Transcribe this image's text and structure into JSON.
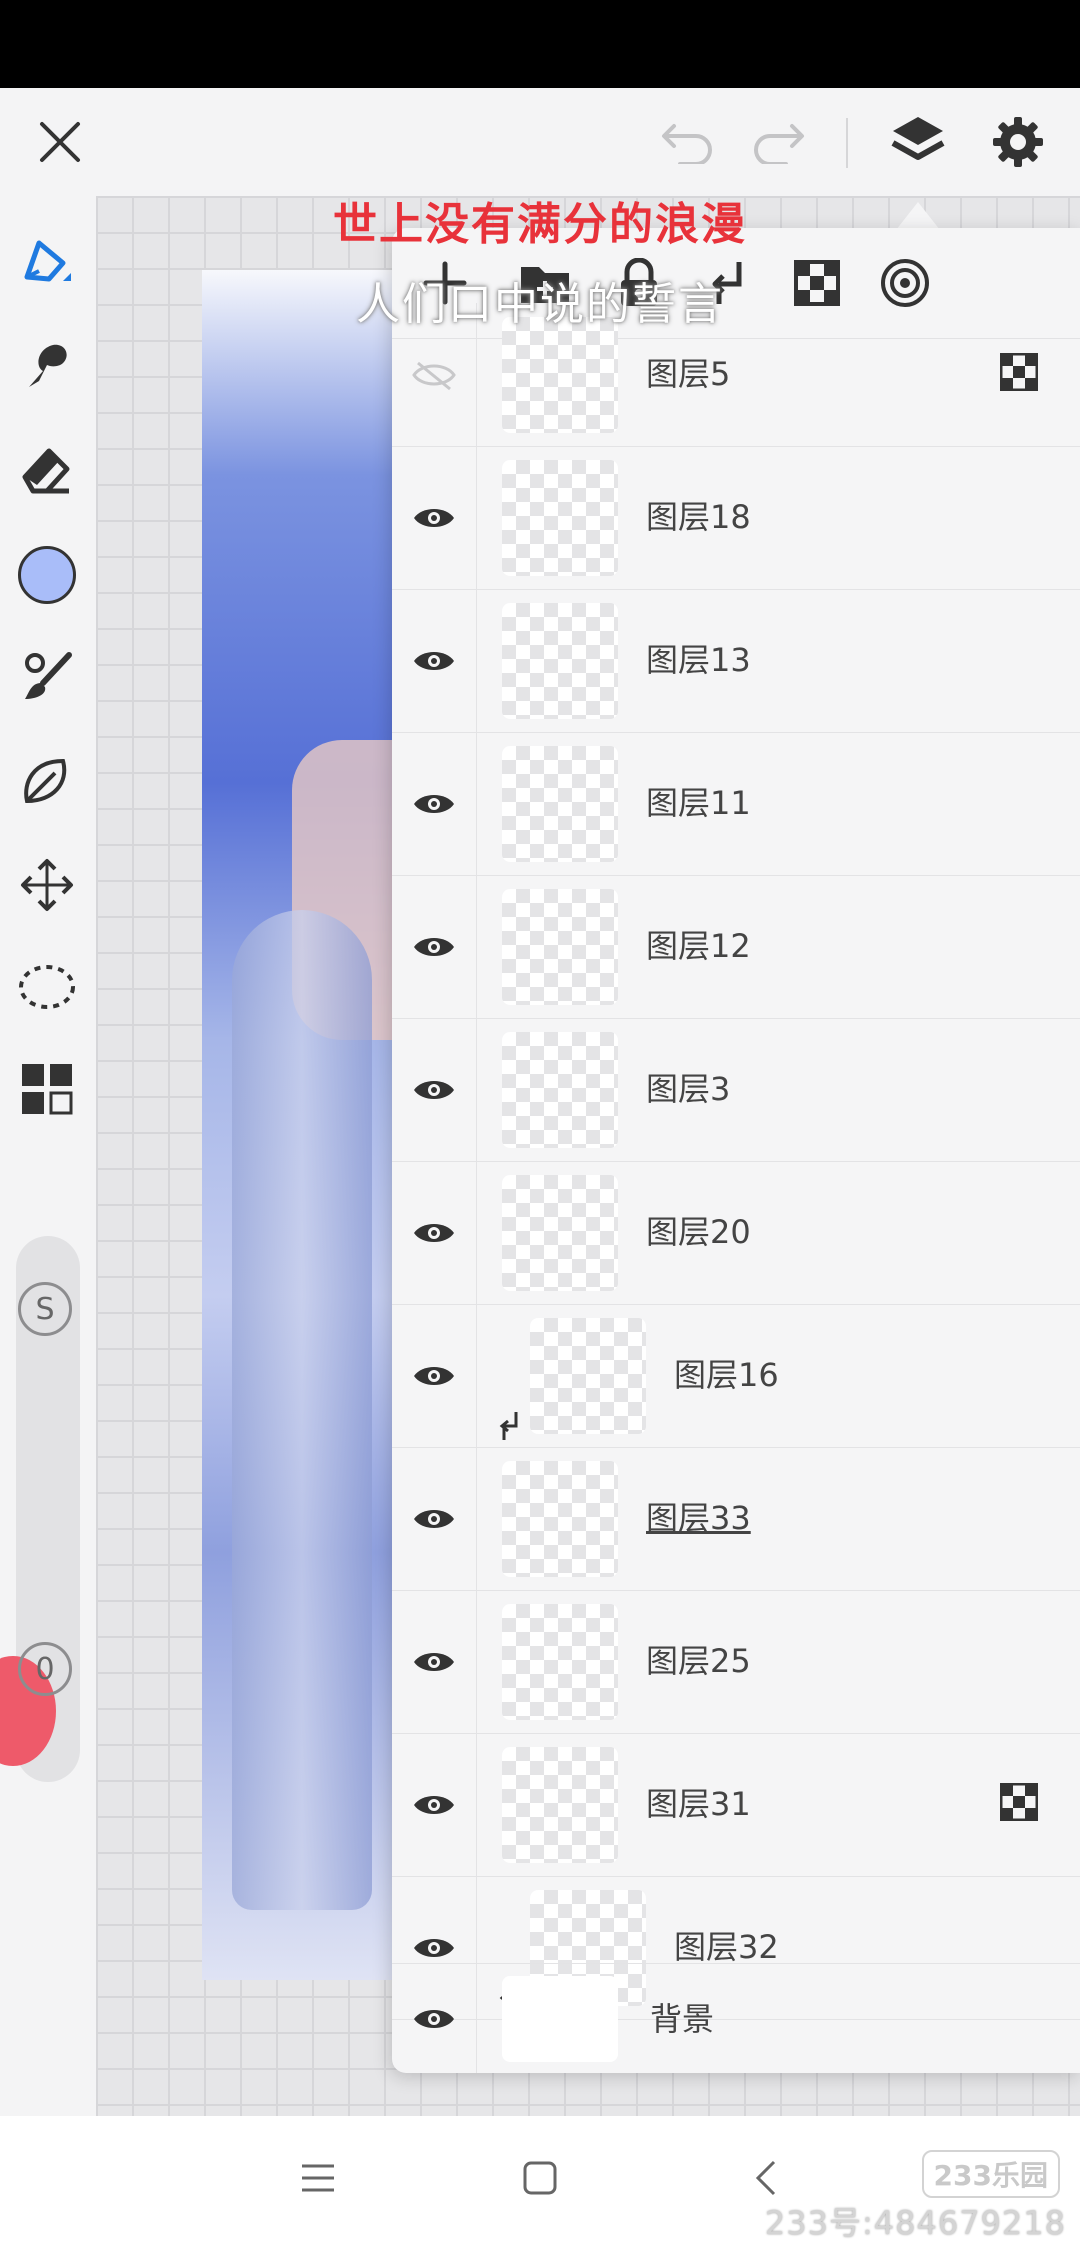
{
  "overlay": {
    "title": "世上没有满分的浪漫",
    "subtitle": "人们口中说的誓言"
  },
  "toolbar": {
    "icons": [
      "close-icon",
      "undo-icon",
      "redo-icon",
      "layers-icon",
      "settings-icon"
    ]
  },
  "tools": [
    "pen-icon",
    "smudge-icon",
    "eraser-icon",
    "color-swatch",
    "brush-icon",
    "lasso-fill-icon",
    "transform-icon",
    "selection-icon",
    "grid-icon"
  ],
  "color": {
    "current": "#a9bdf9",
    "accent": "#1f7ae0"
  },
  "sliders": {
    "size_label": "S",
    "opacity_label": "0"
  },
  "layers_panel": {
    "actions": [
      "add-layer-icon",
      "folder-icon",
      "lock-icon",
      "clip-icon",
      "alpha-lock-icon",
      "blend-mode-icon"
    ],
    "layers": [
      {
        "name": "图层5",
        "visible": false,
        "alpha_locked": true
      },
      {
        "name": "图层18",
        "visible": true
      },
      {
        "name": "图层13",
        "visible": true
      },
      {
        "name": "图层11",
        "visible": true
      },
      {
        "name": "图层12",
        "visible": true
      },
      {
        "name": "图层3",
        "visible": true
      },
      {
        "name": "图层20",
        "visible": true
      },
      {
        "name": "图层16",
        "visible": true,
        "clipped": true
      },
      {
        "name": "图层33",
        "visible": true,
        "selected": true
      },
      {
        "name": "图层25",
        "visible": true
      },
      {
        "name": "图层31",
        "visible": true,
        "alpha_locked": true
      },
      {
        "name": "图层32",
        "visible": true,
        "clipped": true
      }
    ],
    "background": {
      "name": "背景",
      "visible": true
    }
  },
  "watermark": {
    "logo": "233乐园",
    "id": "233号:484679218"
  }
}
